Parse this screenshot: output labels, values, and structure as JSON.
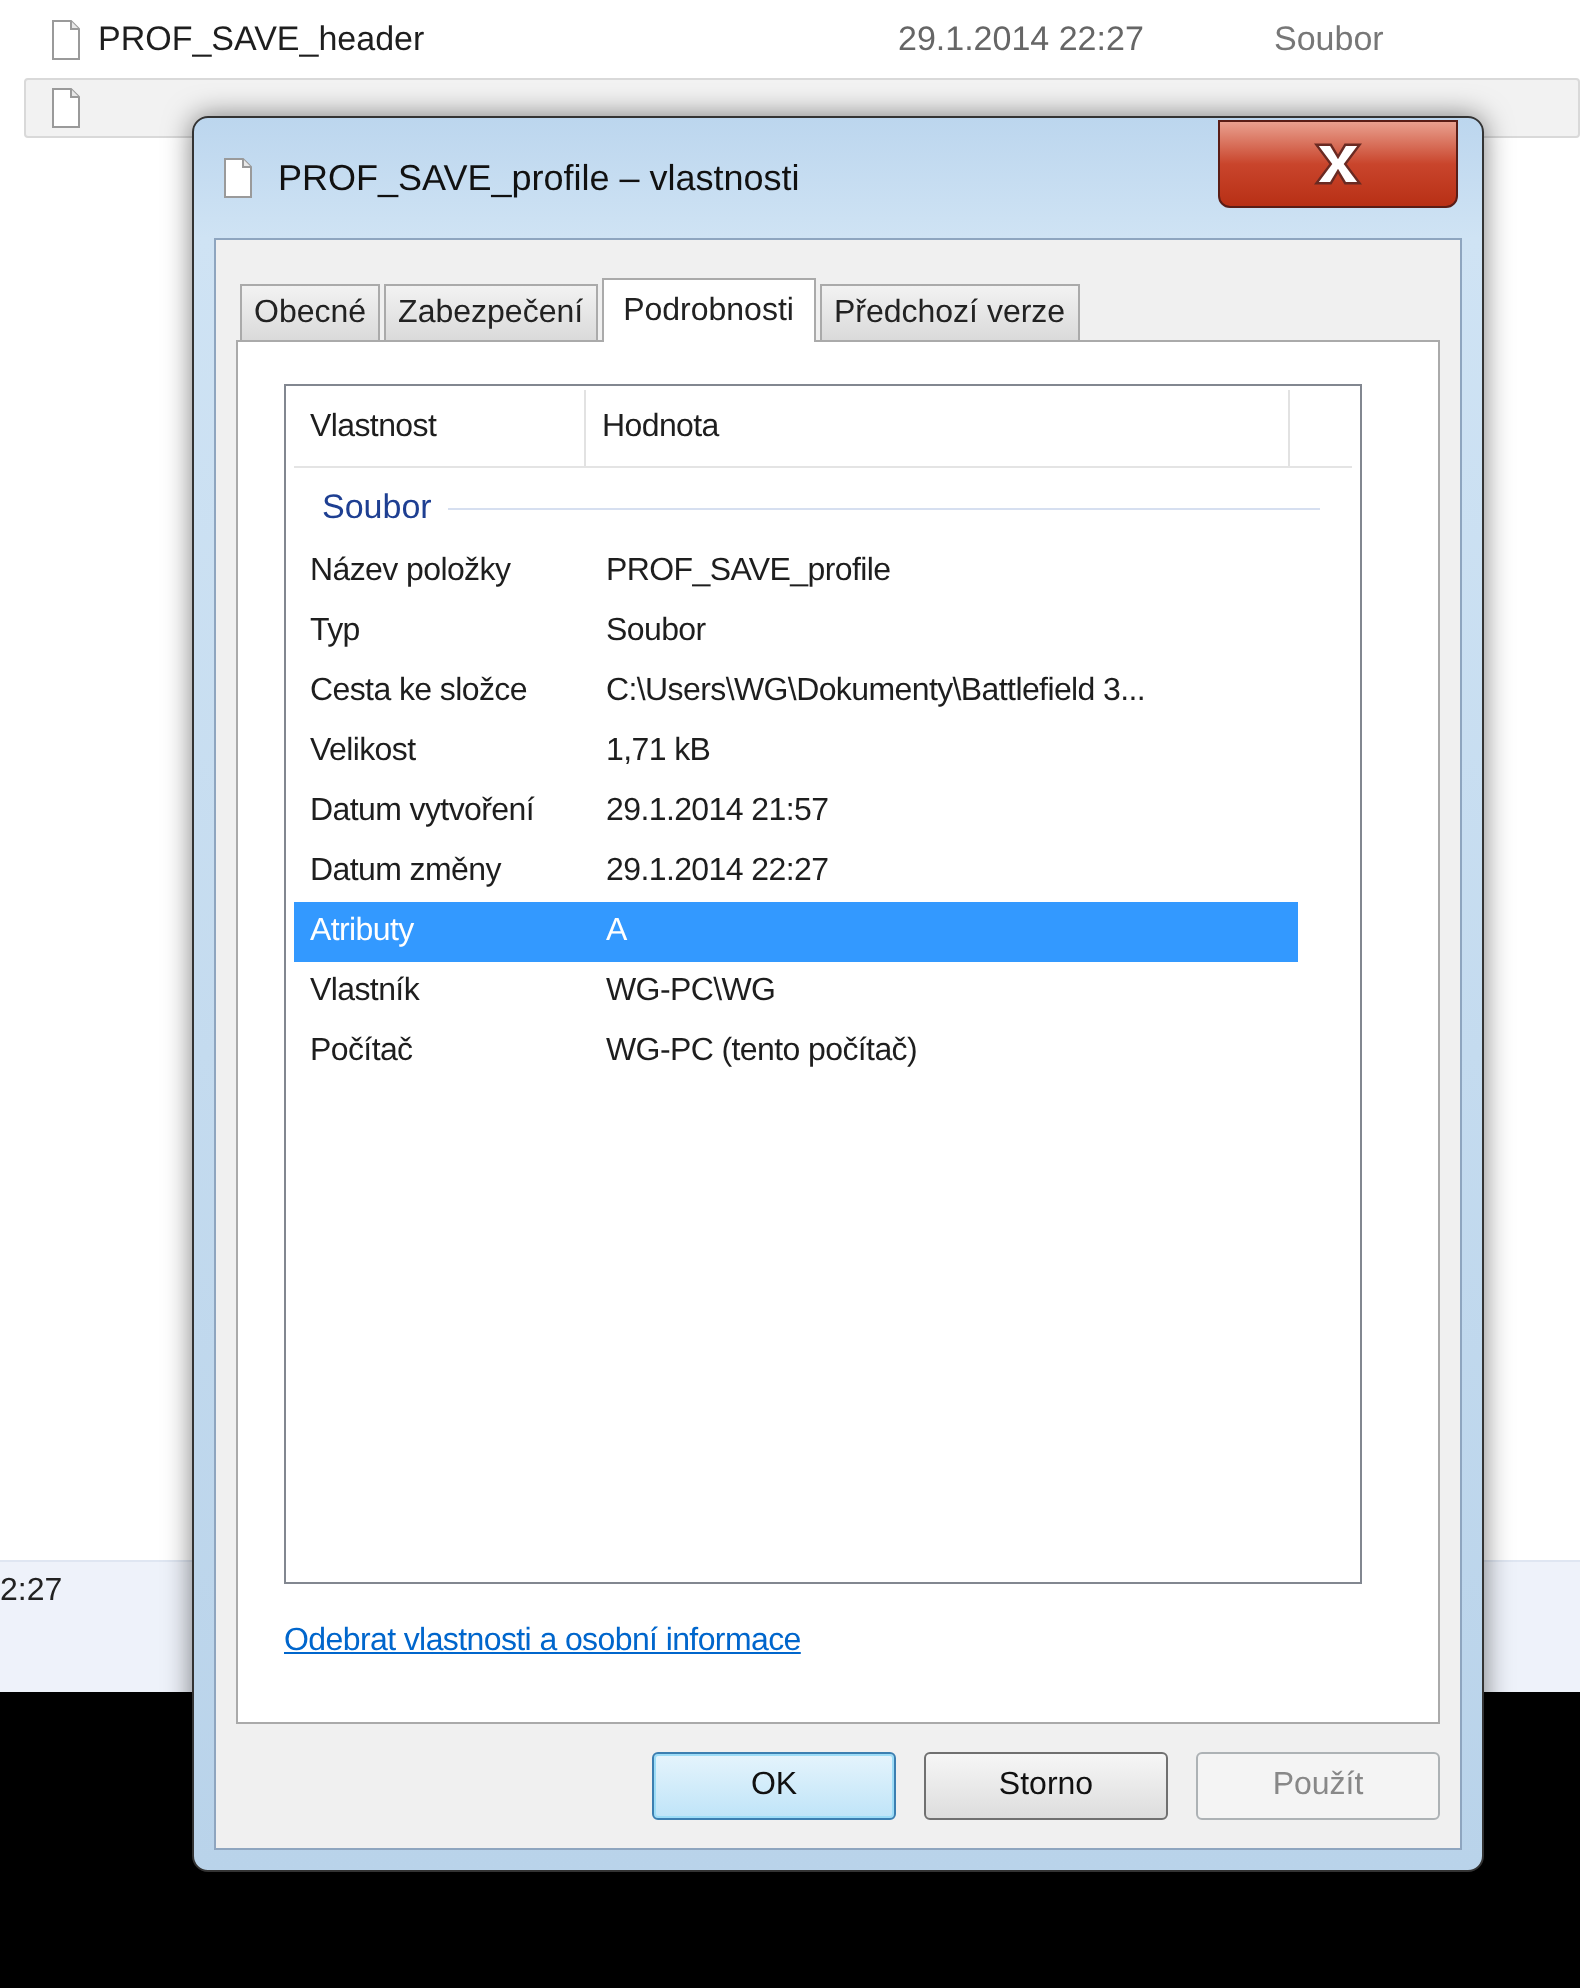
{
  "explorer": {
    "files": [
      {
        "name": "PROF_SAVE_header",
        "date": "29.1.2014 22:27",
        "type": "Soubor",
        "selected": false
      },
      {
        "selected": true
      }
    ],
    "details_pane": {
      "text": "2:27"
    }
  },
  "dialog": {
    "title": "PROF_SAVE_profile – vlastnosti",
    "tabs": [
      {
        "label": "Obecné",
        "selected": false
      },
      {
        "label": "Zabezpečení",
        "selected": false
      },
      {
        "label": "Podrobnosti",
        "selected": true
      },
      {
        "label": "Předchozí verze",
        "selected": false
      }
    ],
    "table": {
      "columns": [
        "Vlastnost",
        "Hodnota"
      ],
      "groups": [
        {
          "name": "Soubor",
          "rows": [
            {
              "property": "Název položky",
              "value": "PROF_SAVE_profile",
              "selected": false
            },
            {
              "property": "Typ",
              "value": "Soubor",
              "selected": false
            },
            {
              "property": "Cesta ke složce",
              "value": "C:\\Users\\WG\\Dokumenty\\Battlefield 3...",
              "selected": false
            },
            {
              "property": "Velikost",
              "value": "1,71 kB",
              "selected": false
            },
            {
              "property": "Datum vytvoření",
              "value": "29.1.2014 21:57",
              "selected": false
            },
            {
              "property": "Datum změny",
              "value": "29.1.2014 22:27",
              "selected": false
            },
            {
              "property": "Atributy",
              "value": "A",
              "selected": true
            },
            {
              "property": "Vlastník",
              "value": "WG-PC\\WG",
              "selected": false
            },
            {
              "property": "Počítač",
              "value": "WG-PC (tento počítač)",
              "selected": false
            }
          ]
        }
      ]
    },
    "link": "Odebrat vlastnosti a osobní informace",
    "buttons": [
      {
        "label": "OK",
        "default": true,
        "disabled": false
      },
      {
        "label": "Storno",
        "default": false,
        "disabled": false
      },
      {
        "label": "Použít",
        "default": false,
        "disabled": true
      }
    ]
  }
}
